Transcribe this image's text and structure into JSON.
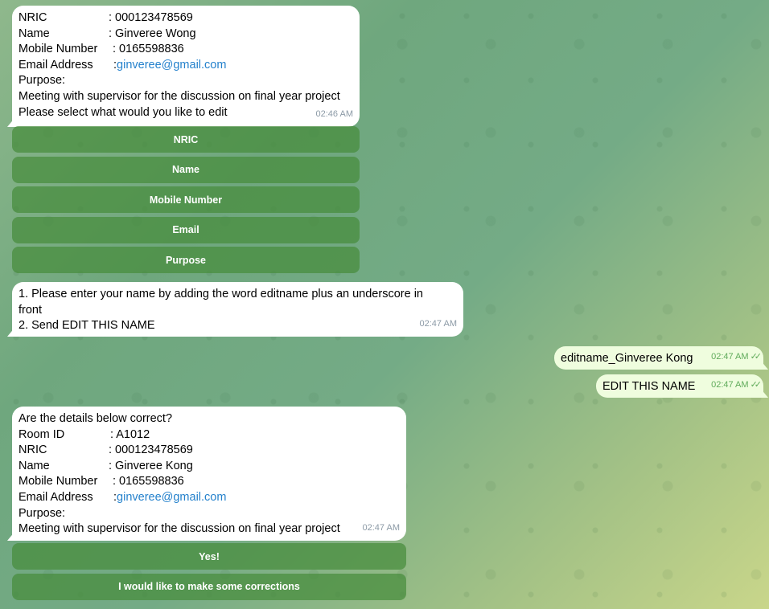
{
  "msg1": {
    "rows": [
      {
        "k": "NRIC",
        "v": ": 000123478569"
      },
      {
        "k": "Name",
        "v": ": Ginveree Wong"
      },
      {
        "k": "Mobile Number",
        "v": ": 0165598836"
      }
    ],
    "email_label": "Email Address",
    "email_sep": ": ",
    "email": "ginveree@gmail.com",
    "purpose_label": "Purpose:",
    "purpose": "Meeting with supervisor for the discussion on final year project",
    "prompt": "Please select what would you like to edit",
    "time": "02:46 AM"
  },
  "keyboard1": [
    "NRIC",
    "Name",
    "Mobile Number",
    "Email",
    "Purpose"
  ],
  "msg2": {
    "line1": "1. Please enter your name by adding the word editname plus an underscore in",
    "line2": "front",
    "line3": "2. Send EDIT THIS NAME",
    "time": "02:47 AM"
  },
  "out1": {
    "text": "editname_Ginveree Kong",
    "time": "02:47 AM",
    "checks": "✓✓"
  },
  "out2": {
    "text": "EDIT THIS NAME",
    "time": "02:47 AM",
    "checks": "✓✓"
  },
  "msg3": {
    "question": "Are the details below correct?",
    "rows": [
      {
        "k": "Room ID",
        "v": ": A1012"
      },
      {
        "k": "NRIC",
        "v": ": 000123478569"
      },
      {
        "k": "Name",
        "v": ": Ginveree Kong"
      },
      {
        "k": "Mobile Number",
        "v": ": 0165598836"
      }
    ],
    "email_label": "Email Address",
    "email_sep": ": ",
    "email": "ginveree@gmail.com",
    "purpose_label": "Purpose:",
    "purpose": "Meeting with supervisor for the discussion on final year project",
    "time": "02:47 AM"
  },
  "keyboard2": [
    "Yes!",
    "I would like to make some corrections"
  ],
  "theme": {
    "incoming": "#ffffff",
    "outgoing": "#effdde",
    "button": "#4f9a45",
    "link": "#2481cc"
  }
}
